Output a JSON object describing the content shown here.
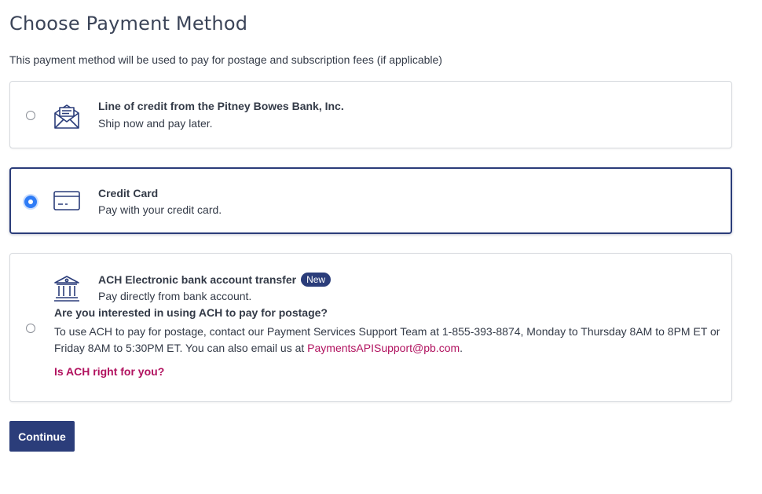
{
  "page": {
    "title": "Choose Payment Method",
    "subtitle": "This payment method will be used to pay for postage and subscription fees (if applicable)"
  },
  "options": [
    {
      "title": "Line of credit from the Pitney Bowes Bank, Inc.",
      "description": "Ship now and pay later.",
      "icon": "envelope-icon",
      "selected": false
    },
    {
      "title": "Credit Card",
      "description": "Pay with your credit card.",
      "icon": "credit-card-icon",
      "selected": true
    },
    {
      "title": "ACH Electronic bank account transfer",
      "badge": "New",
      "description": "Pay directly from bank account.",
      "icon": "bank-icon",
      "selected": false,
      "question": "Are you interested in using ACH to pay for postage?",
      "info_text": "To use ACH to pay for postage, contact our Payment Services Support Team at 1-855-393-8874, Monday to Thursday 8AM to 8PM ET or Friday 8AM to 5:30PM ET. You can also email us at ",
      "email": "PaymentsAPISupport@pb.com",
      "info_suffix": ".",
      "help_link": "Is ACH right for you?"
    }
  ],
  "actions": {
    "continue_label": "Continue"
  },
  "colors": {
    "primary": "#2b3d7a",
    "link": "#b1125f",
    "radio_checked": "#2f7cf6"
  }
}
